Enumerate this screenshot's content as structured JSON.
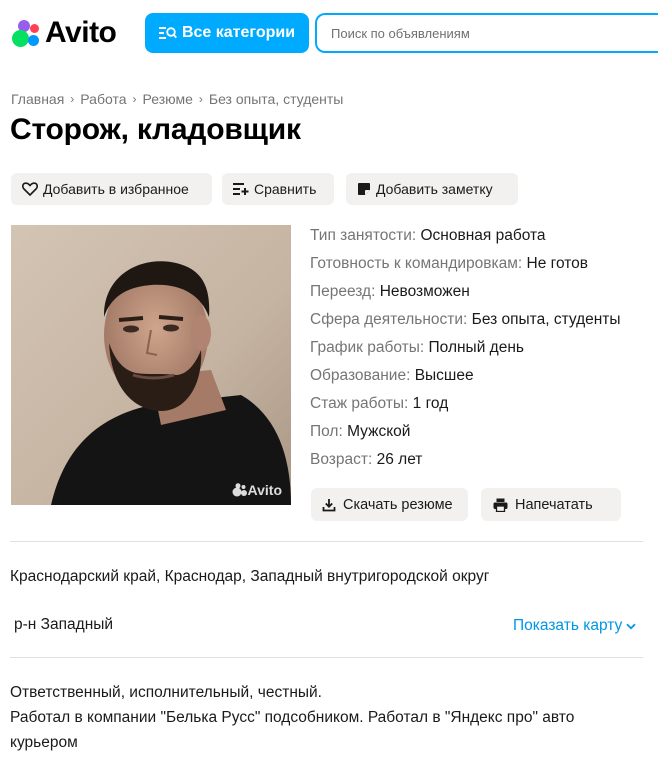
{
  "header": {
    "logo_text": "Avito",
    "categories_label": "Все категории",
    "search_placeholder": "Поиск по объявлениям"
  },
  "breadcrumbs": [
    "Главная",
    "Работа",
    "Резюме",
    "Без опыта, студенты"
  ],
  "title": "Сторож, кладовщик",
  "actions": {
    "favorite_label": "Добавить в избранное",
    "compare_label": "Сравнить",
    "note_label": "Добавить заметку"
  },
  "photo": {
    "watermark": "Avito"
  },
  "params": [
    {
      "key": "Тип занятости:",
      "value": "Основная работа"
    },
    {
      "key": "Готовность к командировкам:",
      "value": "Не готов"
    },
    {
      "key": "Переезд:",
      "value": "Невозможен"
    },
    {
      "key": "Сфера деятельности:",
      "value": "Без опыта, студенты"
    },
    {
      "key": "График работы:",
      "value": "Полный день"
    },
    {
      "key": "Образование:",
      "value": "Высшее"
    },
    {
      "key": "Стаж работы:",
      "value": "1 год"
    },
    {
      "key": "Пол:",
      "value": "Мужской"
    },
    {
      "key": "Возраст:",
      "value": "26 лет"
    }
  ],
  "resume_actions": {
    "download_label": "Скачать резюме",
    "print_label": "Напечатать"
  },
  "location": {
    "address": "Краснодарский край, Краснодар, Западный внутригородской округ",
    "district": "р-н Западный",
    "show_map_label": "Показать карту"
  },
  "description": [
    "Ответственный, исполнительный, честный.",
    "Работал в компании \"Белька Русс\" подсобником. Работал в \"Яндекс про\" авто курьером"
  ],
  "colors": {
    "accent": "#00aaff",
    "link": "#0095e6",
    "button_bg": "#f2f1f0",
    "muted_text": "#757575"
  }
}
